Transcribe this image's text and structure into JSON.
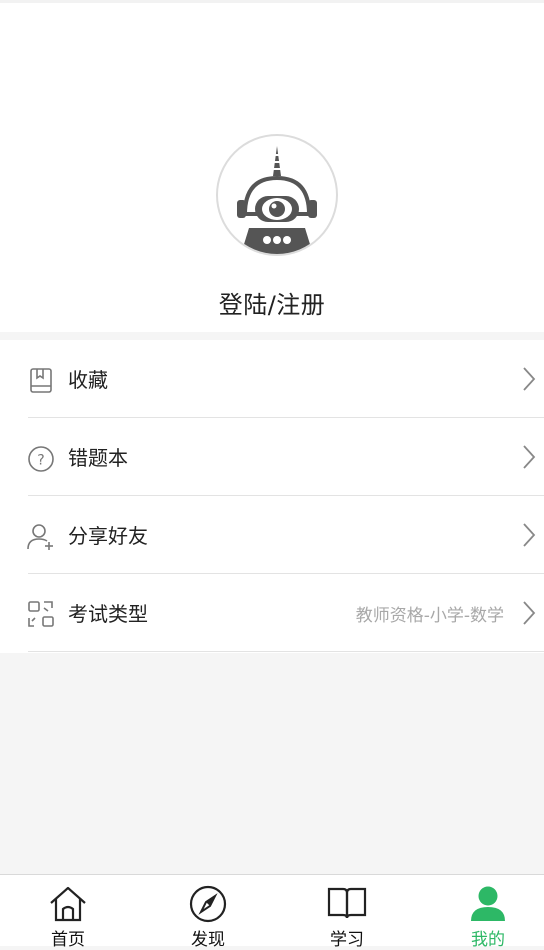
{
  "profile": {
    "login_label": "登陆/注册"
  },
  "menu": {
    "items": [
      {
        "label": "收藏",
        "icon": "bookmark-book-icon"
      },
      {
        "label": "错题本",
        "icon": "question-circle-icon"
      },
      {
        "label": "分享好友",
        "icon": "add-user-icon"
      },
      {
        "label": "考试类型",
        "icon": "category-icon",
        "value": "教师资格-小学-数学"
      }
    ]
  },
  "tabbar": {
    "tabs": [
      {
        "label": "首页",
        "icon": "home-icon"
      },
      {
        "label": "发现",
        "icon": "compass-icon"
      },
      {
        "label": "学习",
        "icon": "open-book-icon"
      },
      {
        "label": "我的",
        "icon": "user-icon",
        "active": true
      }
    ],
    "active_color": "#2db866"
  }
}
